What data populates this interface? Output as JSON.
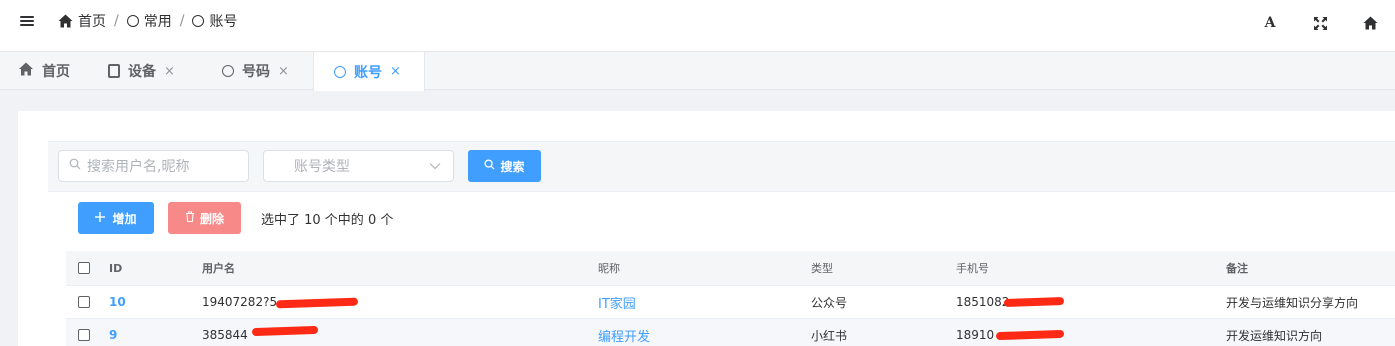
{
  "breadcrumb": [
    {
      "label": "首页",
      "icon": "home-icon"
    },
    {
      "label": "常用",
      "icon": "circle-icon"
    },
    {
      "label": "账号",
      "icon": "circle-icon"
    }
  ],
  "breadcrumb_separator": "/",
  "top_actions": [
    {
      "name": "font-size-icon",
      "glyph": "A"
    },
    {
      "name": "fullscreen-icon",
      "glyph": "⛶"
    },
    {
      "name": "home-icon",
      "glyph": ""
    }
  ],
  "tabs": [
    {
      "label": "首页",
      "icon": "home-icon",
      "closable": false,
      "active": false
    },
    {
      "label": "设备",
      "icon": "tablet-icon",
      "closable": true,
      "active": false
    },
    {
      "label": "号码",
      "icon": "circle-icon",
      "closable": true,
      "active": false
    },
    {
      "label": "账号",
      "icon": "circle-icon",
      "closable": true,
      "active": true
    }
  ],
  "tab_close_glyph": "×",
  "filters": {
    "search_placeholder": "搜索用户名,昵称",
    "type_placeholder": "账号类型",
    "search_button": "搜索"
  },
  "toolbar": {
    "add_label": "增加",
    "delete_label": "删除",
    "selection_info": "选中了 10 个中的 0 个"
  },
  "table": {
    "columns": [
      "ID",
      "用户名",
      "昵称",
      "类型",
      "手机号",
      "备注"
    ],
    "rows": [
      {
        "id": "10",
        "username": "19407282?5",
        "nickname": "IT家园",
        "type": "公众号",
        "phone": "1851082",
        "note": "开发与运维知识分享方向"
      },
      {
        "id": "9",
        "username": "385844",
        "nickname": "编程开发",
        "type": "小红书",
        "phone": "18910",
        "note": "开发运维知识方向"
      }
    ]
  },
  "colors": {
    "accent": "#409eff",
    "danger": "#f78989",
    "redaction": "#ff2a16"
  }
}
